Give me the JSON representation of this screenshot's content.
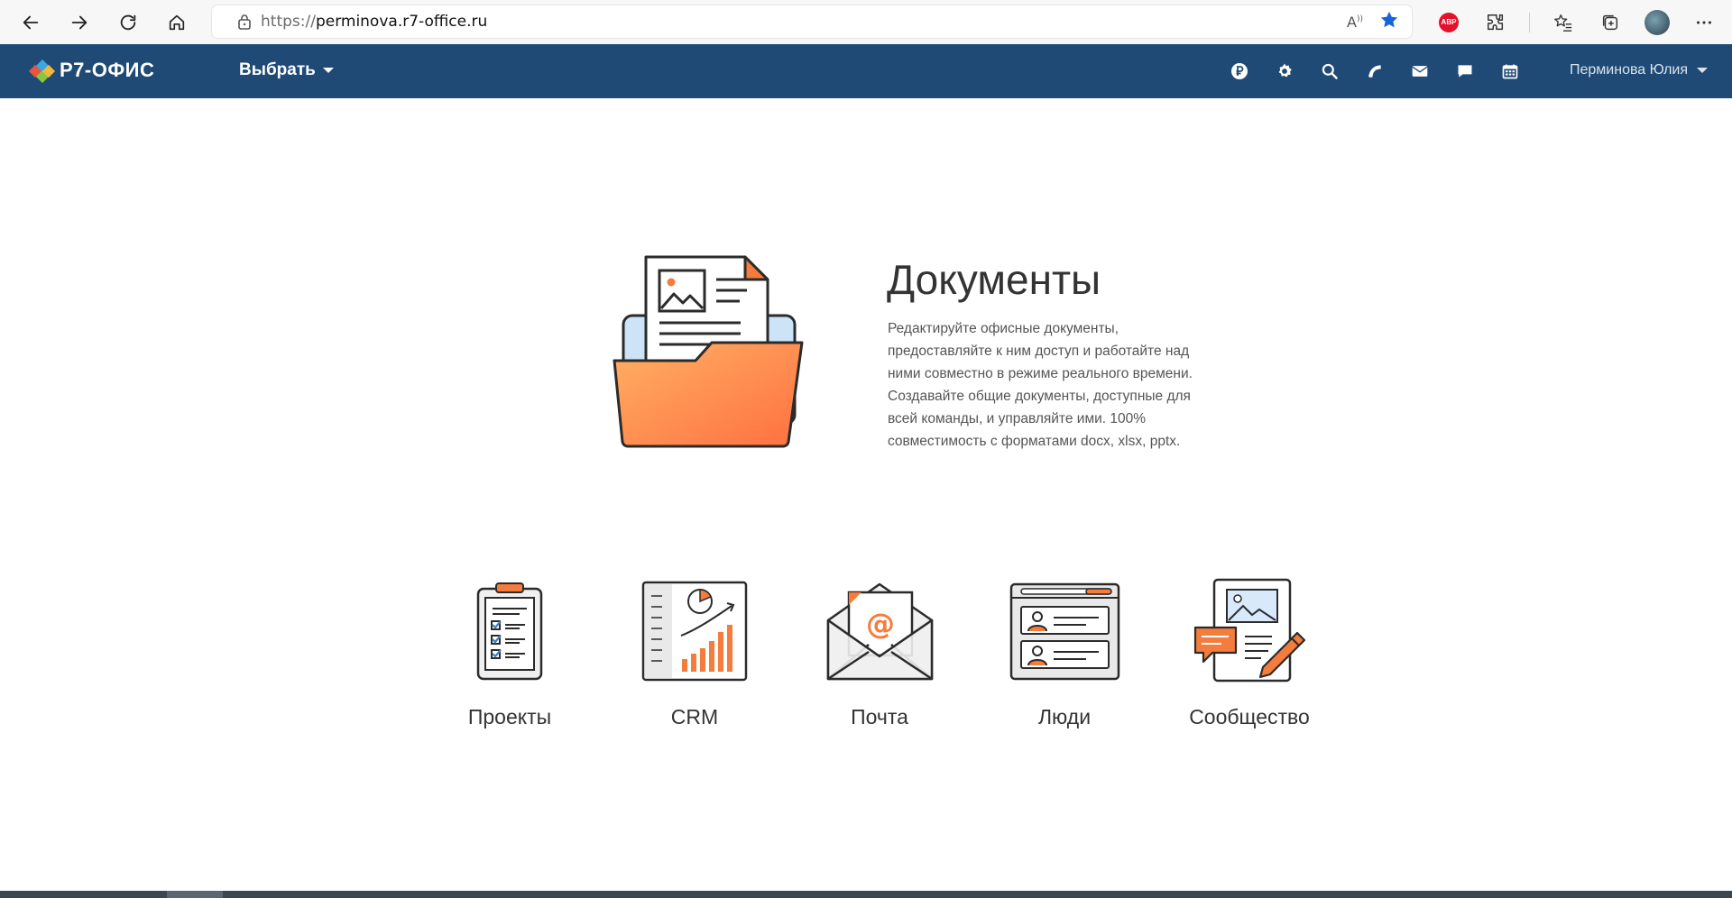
{
  "browser": {
    "url_protocol": "https://",
    "url_host": "perminova.r7-office.ru"
  },
  "header": {
    "logo_text": "Р7-ОФИС",
    "chooser_label": "Выбрать",
    "user_name": "Перминова Юлия",
    "icons": [
      "ruble-icon",
      "gear-icon",
      "search-icon",
      "feed-icon",
      "mail-icon",
      "chat-icon",
      "calendar-icon"
    ]
  },
  "hero": {
    "title": "Документы",
    "description": "Редактируйте офисные документы, предоставляйте к ним доступ и работайте над ними совместно в режиме реального времени. Создавайте общие документы, доступные для всей команды, и управляйте ими. 100% совместимость с форматами docx, xlsx, pptx."
  },
  "modules": [
    {
      "label": "Проекты"
    },
    {
      "label": "CRM"
    },
    {
      "label": "Почта"
    },
    {
      "label": "Люди"
    },
    {
      "label": "Сообщество"
    }
  ],
  "colors": {
    "header_bg": "#1f4a75",
    "accent_orange": "#f47c3c"
  }
}
